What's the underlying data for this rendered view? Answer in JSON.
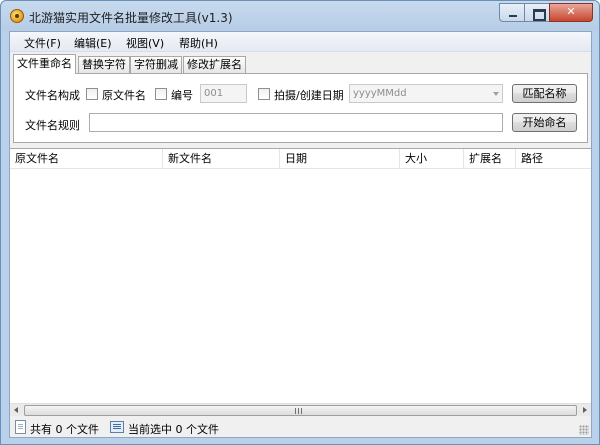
{
  "window": {
    "title": "北游猫实用文件名批量修改工具(v1.3)"
  },
  "menu": [
    {
      "label": "文件(F)"
    },
    {
      "label": "编辑(E)"
    },
    {
      "label": "视图(V)"
    },
    {
      "label": "帮助(H)"
    }
  ],
  "tabs": [
    {
      "label": "文件重命名",
      "active": true
    },
    {
      "label": "替换字符",
      "active": false
    },
    {
      "label": "字符删减",
      "active": false
    },
    {
      "label": "修改扩展名",
      "active": false
    }
  ],
  "rename": {
    "composition_label": "文件名构成",
    "original_name_label": "原文件名",
    "number_label": "编号",
    "number_value": "001",
    "date_label": "拍摄/创建日期",
    "date_format": "yyyyMMdd",
    "match_button": "匹配名称",
    "rule_label": "文件名规则",
    "rule_value": "",
    "start_button": "开始命名"
  },
  "table": {
    "columns": [
      "原文件名",
      "新文件名",
      "日期",
      "大小",
      "扩展名",
      "路径"
    ],
    "rows": []
  },
  "status": {
    "total": "共有 0 个文件",
    "selected": "当前选中 0 个文件"
  },
  "colors": {
    "titlebar": "#c7daee",
    "client": "#f0f0f0",
    "close_button": "#c7452f"
  }
}
